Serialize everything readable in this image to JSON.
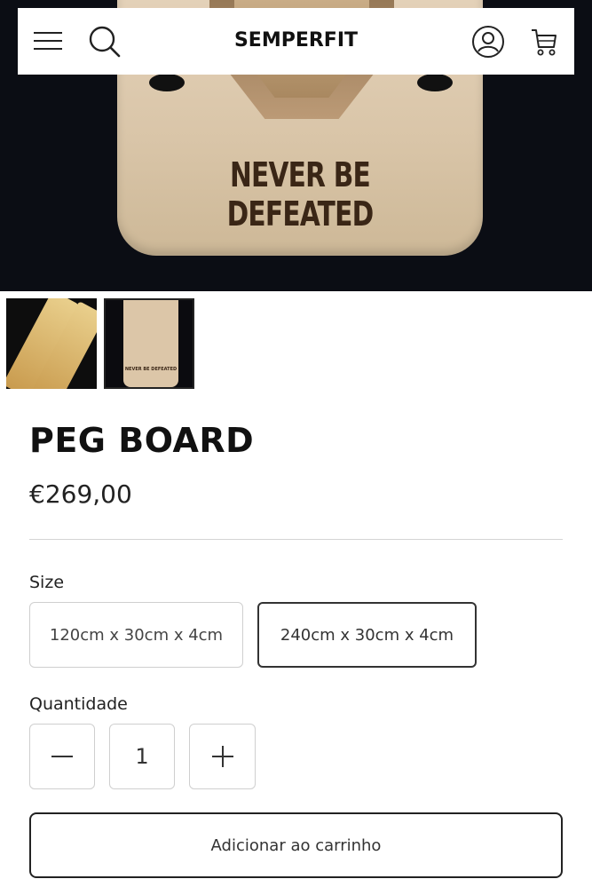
{
  "header": {
    "brand": "SEMPERFIT",
    "icons": [
      "menu-icon",
      "search-icon",
      "account-icon",
      "cart-icon"
    ]
  },
  "hero": {
    "board_text": "NEVER BE DEFEATED"
  },
  "gallery": {
    "thumbnails": [
      {
        "name": "thumbnail-1",
        "selected": false
      },
      {
        "name": "thumbnail-2",
        "selected": true,
        "board_text": "NEVER BE DEFEATED"
      }
    ]
  },
  "product": {
    "title": "PEG BOARD",
    "price": "€269,00"
  },
  "size": {
    "label": "Size",
    "options": [
      {
        "label": "120cm x 30cm x 4cm",
        "selected": false
      },
      {
        "label": "240cm x 30cm x 4cm",
        "selected": true
      }
    ]
  },
  "quantity": {
    "label": "Quantidade",
    "value": "1"
  },
  "actions": {
    "add_to_cart_label": "Adicionar ao carrinho"
  },
  "colors": {
    "text": "#1a1a1a",
    "border": "#cfcfcf",
    "selected_border": "#333333",
    "hero_background": "#0b0d14"
  }
}
